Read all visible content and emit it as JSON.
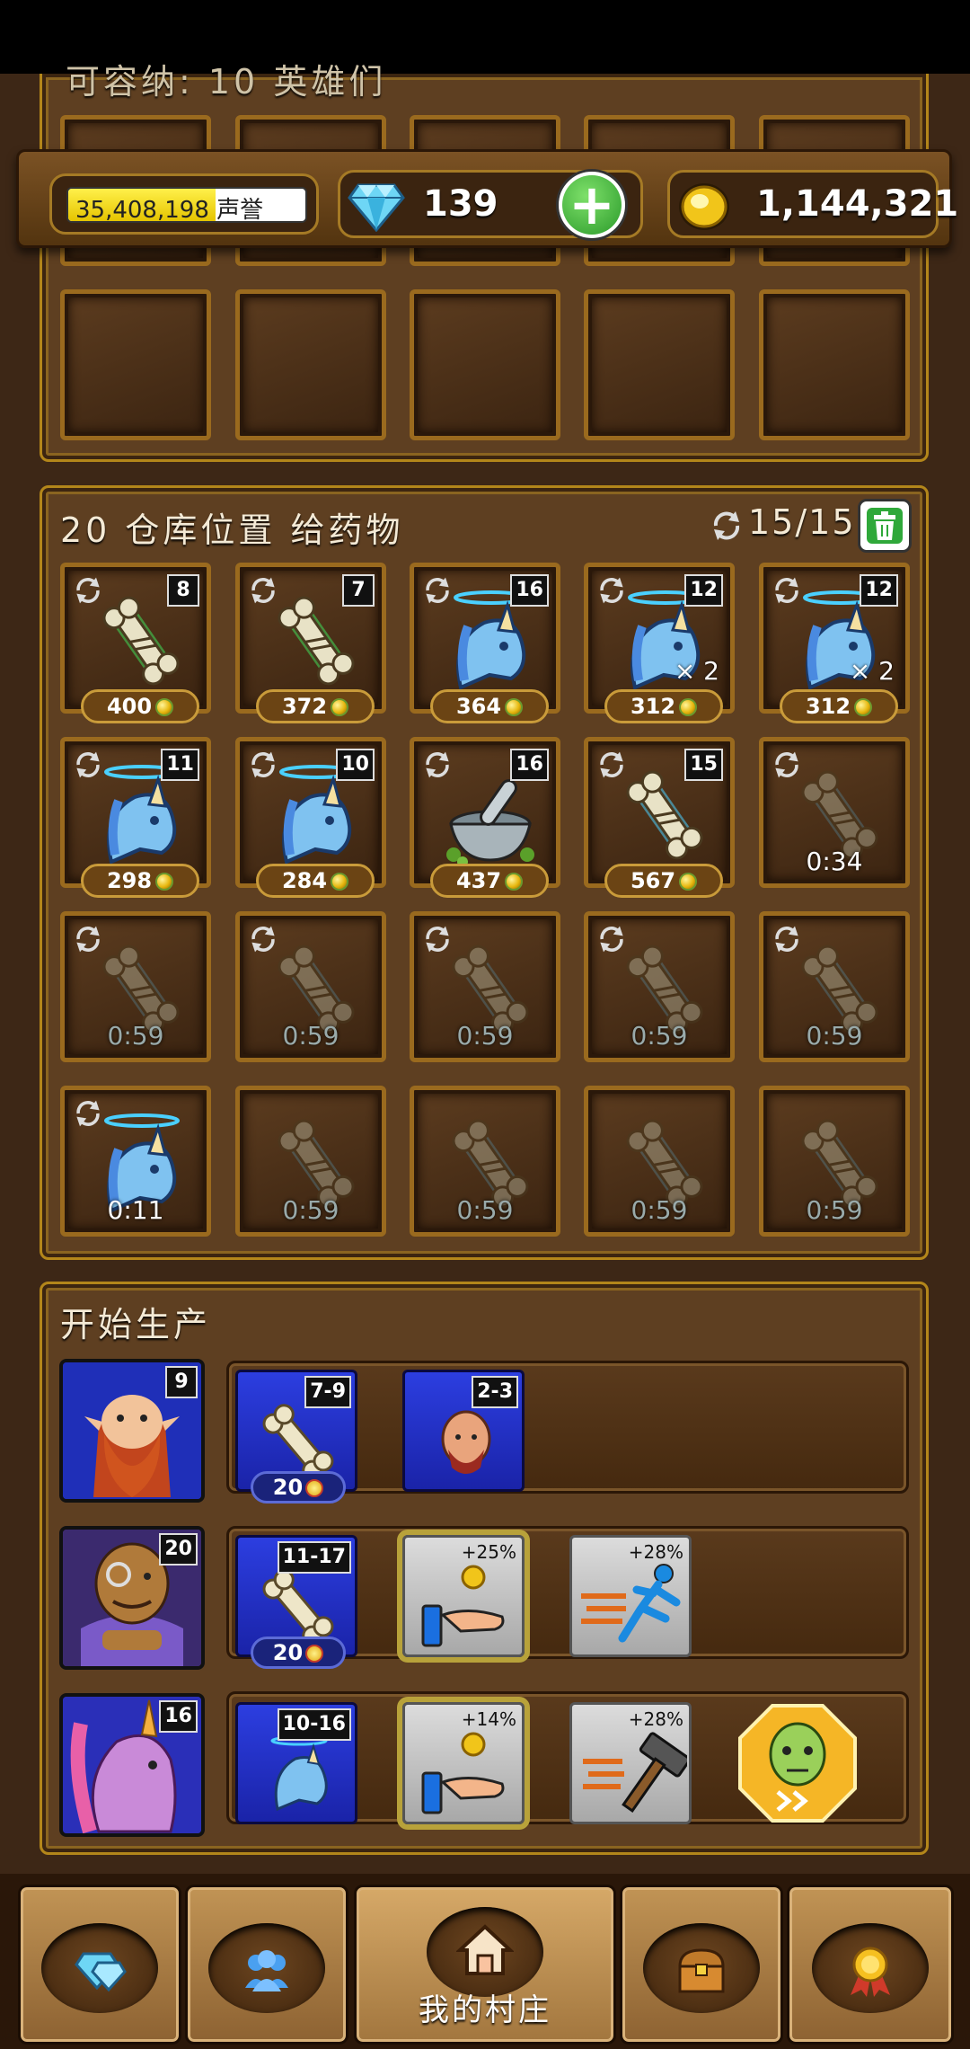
{
  "top_panel": {
    "title": "可容纳: 10 英雄们"
  },
  "resources": {
    "reputation_value": "35,408,198",
    "reputation_label": "声誉",
    "reputation_fill": 0.62,
    "gems": "139",
    "coins": "1,144,321"
  },
  "storage": {
    "title": "20 仓库位置 给药物",
    "capacity": "15/15",
    "slots": [
      {
        "item": "bone-green",
        "level": "8",
        "price": "400",
        "timer": "",
        "mult": ""
      },
      {
        "item": "bone-green",
        "level": "7",
        "price": "372",
        "timer": "",
        "mult": ""
      },
      {
        "item": "unicorn",
        "level": "16",
        "price": "364",
        "timer": "",
        "mult": ""
      },
      {
        "item": "unicorn",
        "level": "12",
        "price": "312",
        "timer": "",
        "mult": "× 2"
      },
      {
        "item": "unicorn",
        "level": "12",
        "price": "312",
        "timer": "",
        "mult": "× 2"
      },
      {
        "item": "unicorn",
        "level": "11",
        "price": "298",
        "timer": "",
        "mult": ""
      },
      {
        "item": "unicorn",
        "level": "10",
        "price": "284",
        "timer": "",
        "mult": ""
      },
      {
        "item": "mortar",
        "level": "16",
        "price": "437",
        "timer": "",
        "mult": ""
      },
      {
        "item": "bone-blue",
        "level": "15",
        "price": "567",
        "timer": "",
        "mult": ""
      },
      {
        "item": "bone-gray",
        "level": "",
        "price": "",
        "timer": "0:34",
        "mult": ""
      },
      {
        "item": "bone-gray",
        "level": "",
        "price": "",
        "timer": "0:59",
        "mult": ""
      },
      {
        "item": "bone-gray",
        "level": "",
        "price": "",
        "timer": "0:59",
        "mult": ""
      },
      {
        "item": "bone-gray",
        "level": "",
        "price": "",
        "timer": "0:59",
        "mult": ""
      },
      {
        "item": "bone-gray",
        "level": "",
        "price": "",
        "timer": "0:59",
        "mult": ""
      },
      {
        "item": "bone-gray",
        "level": "",
        "price": "",
        "timer": "0:59",
        "mult": ""
      },
      {
        "item": "unicorn",
        "level": "",
        "price": "",
        "timer": "0:11",
        "mult": ""
      },
      {
        "item": "bone-gray",
        "level": "",
        "price": "",
        "timer": "0:59",
        "mult": ""
      },
      {
        "item": "bone-gray",
        "level": "",
        "price": "",
        "timer": "0:59",
        "mult": ""
      },
      {
        "item": "bone-gray",
        "level": "",
        "price": "",
        "timer": "0:59",
        "mult": ""
      },
      {
        "item": "bone-gray",
        "level": "",
        "price": "",
        "timer": "0:59",
        "mult": ""
      }
    ]
  },
  "production": {
    "title": "开始生产",
    "rows": [
      {
        "portrait": "dwarf",
        "level": "9",
        "recipe_level": "7-9",
        "cost": "20",
        "second_level": "2-3"
      },
      {
        "portrait": "monocle-man",
        "level": "20",
        "recipe_level": "11-17",
        "cost": "20",
        "boost1": "+25%",
        "boost2": "+28%"
      },
      {
        "portrait": "pink-unicorn",
        "level": "16",
        "recipe_level": "10-16",
        "boost1": "+14%",
        "boost2": "+28%"
      }
    ]
  },
  "nav": {
    "tabs": [
      "gems-shop",
      "heroes",
      "我的村庄",
      "treasure",
      "awards"
    ],
    "active_label": "我的村庄"
  }
}
